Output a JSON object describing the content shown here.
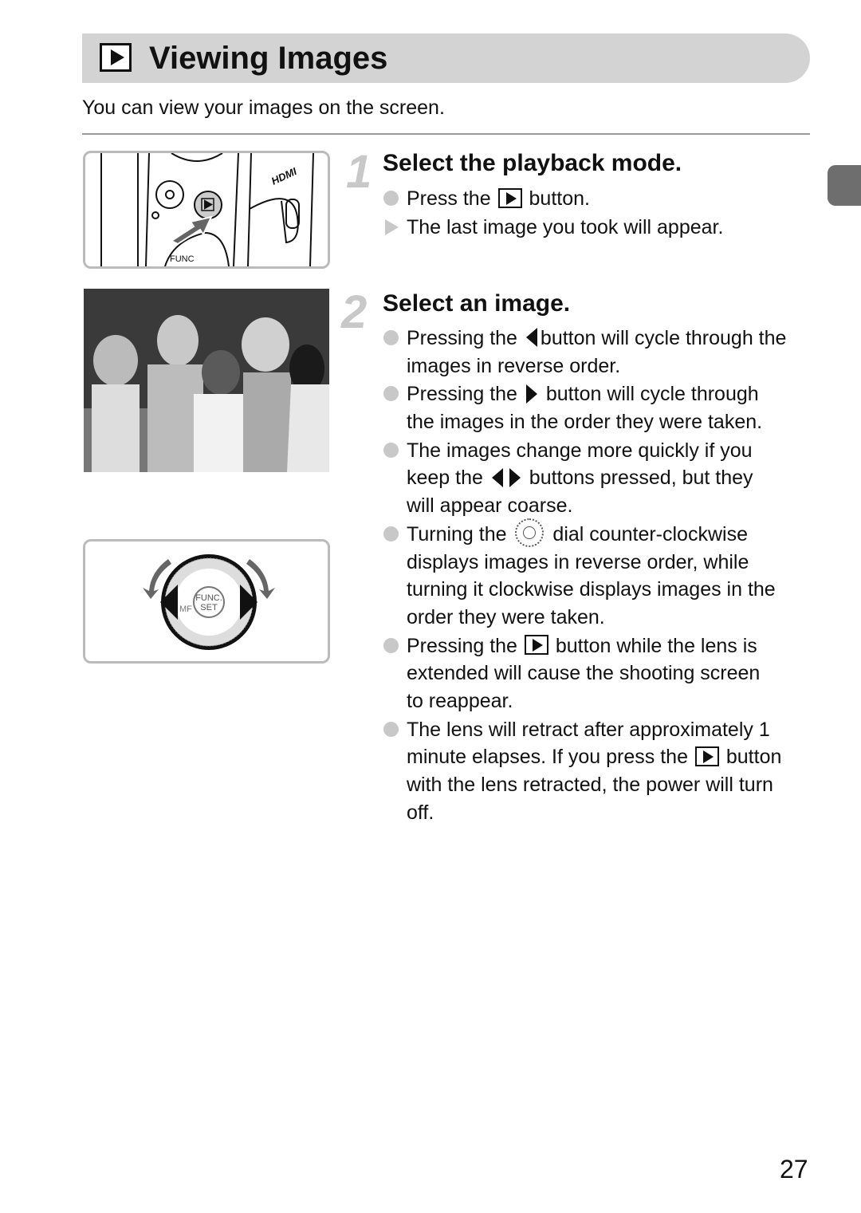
{
  "header": {
    "title": "Viewing Images",
    "title_icon": "playback-icon",
    "subtitle": "You can view your images on the screen."
  },
  "steps": [
    {
      "number": "1",
      "title": "Select the playback mode.",
      "items": [
        {
          "marker": "bullet",
          "lines": [
            [
              "Press the ",
              {
                "icon": "play"
              },
              " button."
            ]
          ]
        },
        {
          "marker": "result",
          "lines": [
            [
              "The last image you took will appear."
            ]
          ]
        }
      ]
    },
    {
      "number": "2",
      "title": "Select an image.",
      "items": [
        {
          "marker": "bullet",
          "lines": [
            [
              "Pressing the ",
              {
                "icon": "left"
              },
              "button will cycle through the"
            ],
            [
              "images in reverse order."
            ]
          ]
        },
        {
          "marker": "bullet",
          "lines": [
            [
              "Pressing the ",
              {
                "icon": "right"
              },
              " button will cycle through"
            ],
            [
              "the images in the order they were taken."
            ]
          ]
        },
        {
          "marker": "bullet",
          "lines": [
            [
              "The images change more quickly if you"
            ],
            [
              "keep the ",
              {
                "icon": "left"
              },
              {
                "icon": "right"
              },
              " buttons pressed, but they"
            ],
            [
              "will appear coarse."
            ]
          ]
        },
        {
          "marker": "bullet",
          "lines": [
            [
              "Turning the ",
              {
                "icon": "dial"
              },
              " dial counter-clockwise"
            ],
            [
              "displays images in reverse order, while"
            ],
            [
              "turning it clockwise displays images in the"
            ],
            [
              "order they were taken."
            ]
          ]
        },
        {
          "marker": "bullet",
          "lines": [
            [
              "Pressing the ",
              {
                "icon": "play"
              },
              " button while the lens is"
            ],
            [
              "extended will cause the shooting screen"
            ],
            [
              "to reappear."
            ]
          ]
        },
        {
          "marker": "bullet",
          "lines": [
            [
              "The lens will retract after approximately 1"
            ],
            [
              "minute elapses. If you press the ",
              {
                "icon": "play"
              },
              " button"
            ],
            [
              "with the lens retracted, the power will turn"
            ],
            [
              "off."
            ]
          ]
        }
      ]
    }
  ],
  "illustrations": {
    "camera_labels": [
      "FUNC",
      "SET",
      "MF",
      "HDMI"
    ],
    "dial_labels": [
      "FUNC.",
      "SET",
      "MF"
    ]
  },
  "page_number": "27",
  "colors": {
    "title_bar": "#d3d3d3",
    "marker": "#c8c8c8",
    "side_tab": "#6e6e6e"
  }
}
